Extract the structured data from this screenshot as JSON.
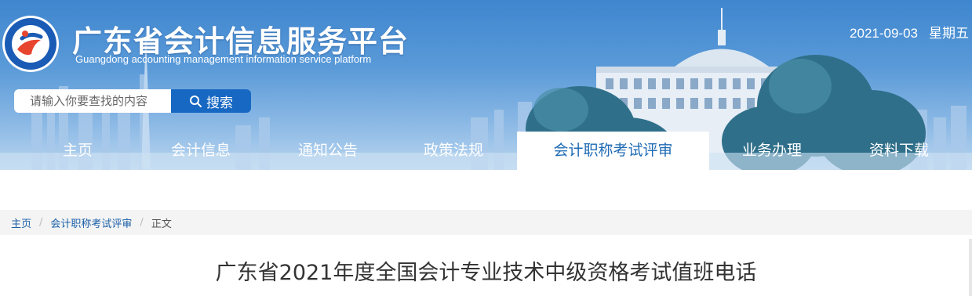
{
  "header": {
    "title": "广东省会计信息服务平台",
    "subtitle": "Guangdong accounting management information service platform",
    "logo_ring_text": "广东省会计管理信息服务平台",
    "date": "2021-09-03",
    "weekday": "星期五"
  },
  "search": {
    "placeholder": "请输入你要查找的内容",
    "button_label": "搜索",
    "button_icon": "search-icon"
  },
  "nav": {
    "items": [
      {
        "label": "主页",
        "active": false
      },
      {
        "label": "会计信息",
        "active": false
      },
      {
        "label": "通知公告",
        "active": false
      },
      {
        "label": "政策法规",
        "active": false
      },
      {
        "label": "会计职称考试评审",
        "active": true
      },
      {
        "label": "业务办理",
        "active": false
      },
      {
        "label": "资料下载",
        "active": false
      }
    ]
  },
  "breadcrumb": {
    "home": "主页",
    "section": "会计职称考试评审",
    "current": "正文",
    "separator": "/"
  },
  "article": {
    "title": "广东省2021年度全国会计专业技术中级资格考试值班电话"
  },
  "colors": {
    "banner_blue": "#3f86cf",
    "search_button": "#1768c2",
    "active_nav_text": "#1f6bb4",
    "link": "#1a5fa8"
  }
}
